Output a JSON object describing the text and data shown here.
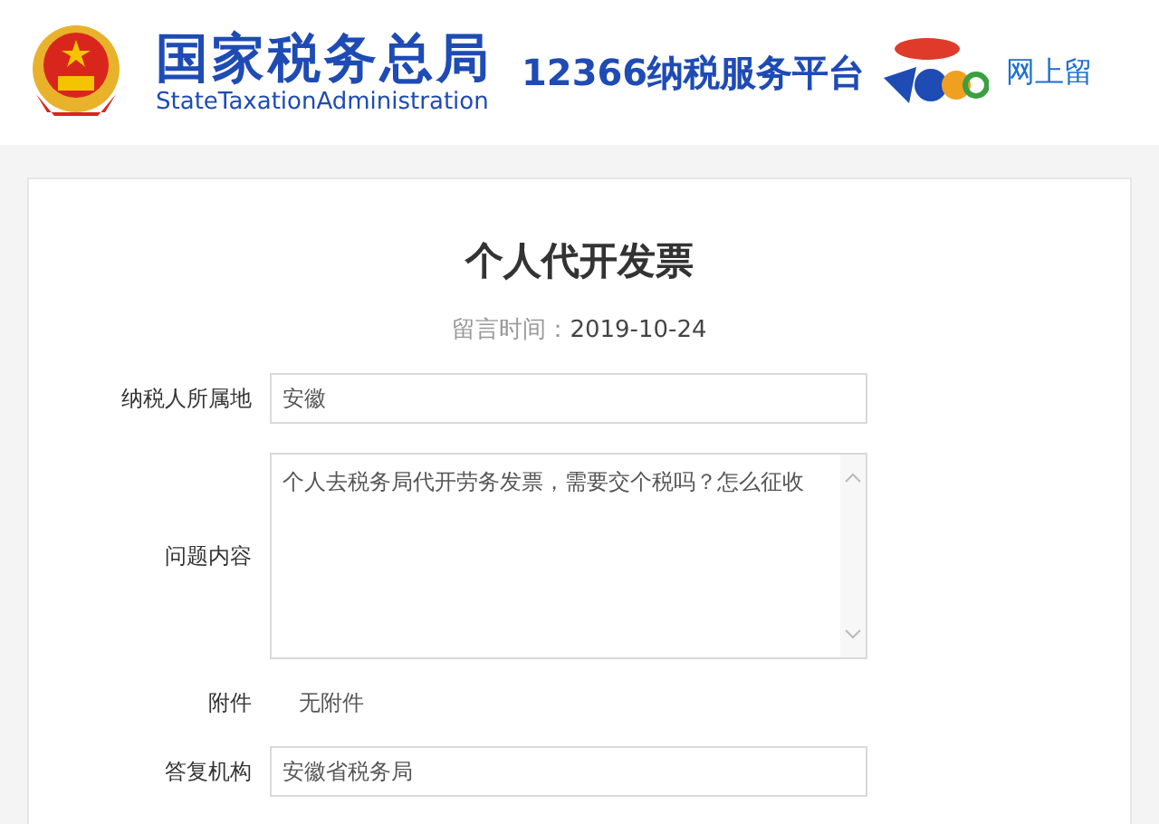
{
  "header": {
    "agency_name": "国家税务总局",
    "agency_name_en": "StateTaxationAdministration",
    "platform": "12366纳税服务平台",
    "nav_link": "网上留"
  },
  "message": {
    "title": "个人代开发票",
    "time_label": "留言时间：",
    "time": "2019-10-24"
  },
  "fields": [
    {
      "kind": "input",
      "label": "纳税人所属地",
      "value": "安徽"
    },
    {
      "kind": "textarea",
      "label": "问题内容",
      "value": "个人去税务局代开劳务发票，需要交个税吗？怎么征收"
    },
    {
      "kind": "text",
      "label": "附件",
      "value": "无附件"
    },
    {
      "kind": "input",
      "label": "答复机构",
      "value": "安徽省税务局"
    }
  ]
}
